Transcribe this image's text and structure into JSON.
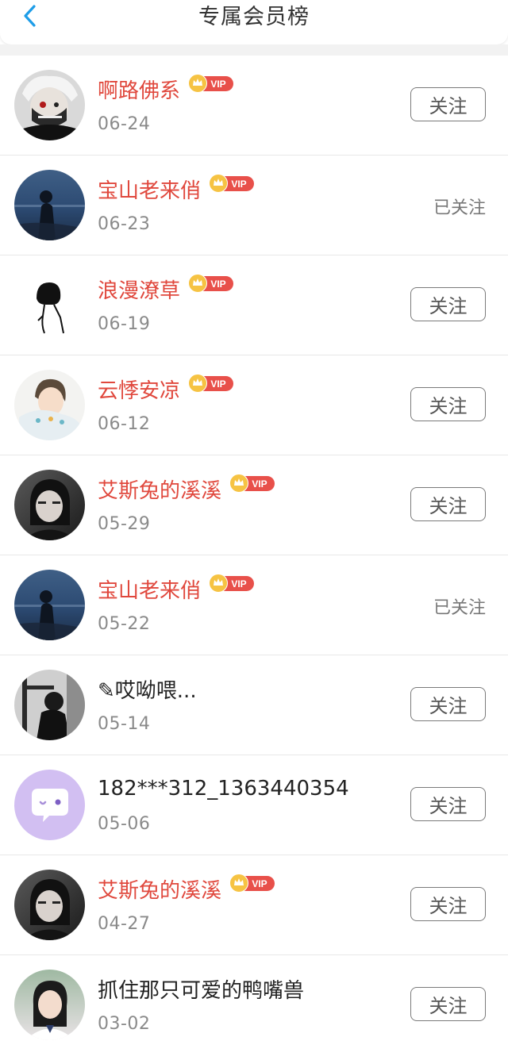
{
  "header": {
    "title": "专属会员榜",
    "back_icon": "chevron-left-icon"
  },
  "colors": {
    "accent": "#1e9de8",
    "vip_name": "#e0483d",
    "vip_badge": "#e8504a",
    "crown": "#f6c343"
  },
  "badge": {
    "label": "VIP",
    "icon": "crown-icon"
  },
  "follow_label": "关注",
  "followed_label": "已关注",
  "members": [
    {
      "name": "啊路佛系",
      "date": "06-24",
      "vip": true,
      "status": "follow",
      "avatar": "avatar-masked-anime"
    },
    {
      "name": "宝山老来俏",
      "date": "06-23",
      "vip": true,
      "status": "followed",
      "avatar": "avatar-sea-silhouette"
    },
    {
      "name": "浪漫潦草",
      "date": "06-19",
      "vip": true,
      "status": "follow",
      "avatar": "avatar-sketch-figure"
    },
    {
      "name": "云悸安凉",
      "date": "06-12",
      "vip": true,
      "status": "follow",
      "avatar": "avatar-anime-boy"
    },
    {
      "name": "艾斯兔的溪溪",
      "date": "05-29",
      "vip": true,
      "status": "follow",
      "avatar": "avatar-portrait-dark"
    },
    {
      "name": "宝山老来俏",
      "date": "05-22",
      "vip": true,
      "status": "followed",
      "avatar": "avatar-sea-silhouette"
    },
    {
      "name": "✎哎呦喂...",
      "date": "05-14",
      "vip": false,
      "status": "follow",
      "avatar": "avatar-bw-photo"
    },
    {
      "name": "182***312_1363440354",
      "date": "05-06",
      "vip": false,
      "status": "follow",
      "avatar": "avatar-default-chat"
    },
    {
      "name": "艾斯兔的溪溪",
      "date": "04-27",
      "vip": true,
      "status": "follow",
      "avatar": "avatar-portrait-dark"
    },
    {
      "name": "抓住那只可爱的鸭嘴兽",
      "date": "03-02",
      "vip": false,
      "status": "follow",
      "avatar": "avatar-girl-photo"
    }
  ]
}
